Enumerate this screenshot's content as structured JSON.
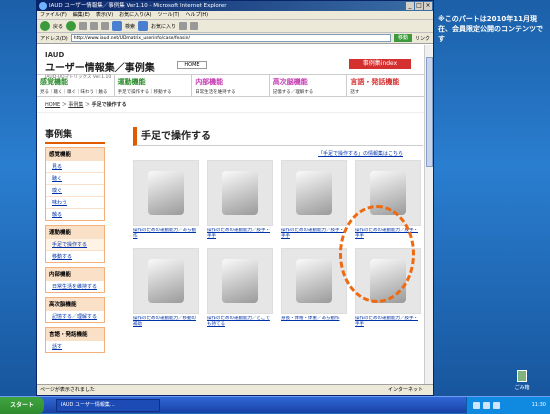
{
  "browser": {
    "title": "IAUD ユーザー情報集／事例集 Ver1.10 - Microsoft Internet Explorer",
    "window_controls": [
      "minimize-icon",
      "maximize-icon",
      "close-icon"
    ],
    "menu": [
      "ファイル(F)",
      "編集(E)",
      "表示(V)",
      "お気に入り(A)",
      "ツール(T)",
      "ヘルプ(H)"
    ],
    "toolbar": {
      "back_label": "戻る",
      "search_label": "検索",
      "favorites_label": "お気に入り"
    },
    "address_label": "アドレス(D)",
    "address_value": "http://www.iaud.net/UDmatrix_userinfo/case/feasin/",
    "go_label": "移動",
    "links_label": "リンク",
    "status_text": "ページが表示されました",
    "status_zone": "インターネット"
  },
  "site": {
    "brand": "IAUD",
    "title": "ユーザー情報集／事例集",
    "subtitle": "IAUD-UDマトリックス Ver.1.10",
    "home_button": "HOME",
    "index_button": "事例集index",
    "categories": [
      {
        "title": "感覚機能",
        "items": "見る｜聴く｜嗅ぐ｜味わう｜触る",
        "color": "#2a8a2a"
      },
      {
        "title": "運動機能",
        "items": "手足で操作する｜移動する",
        "color": "#2a8a2a"
      },
      {
        "title": "内部機能",
        "items": "日常生活を維持する",
        "color": "#c43ab0"
      },
      {
        "title": "高次脳機能",
        "items": "記憶する／理解する",
        "color": "#c43ab0"
      },
      {
        "title": "言語・発話機能",
        "items": "話す",
        "color": "#d43030"
      }
    ],
    "breadcrumb": {
      "home": "HOME",
      "case": "事例集",
      "current": "手足で操作する"
    },
    "sidebar": {
      "title": "事例集",
      "groups": [
        {
          "title": "感覚機能",
          "items": [
            "見る",
            "聴く",
            "嗅ぐ",
            "味わう",
            "触る"
          ]
        },
        {
          "title": "運動機能",
          "items": [
            "手足で操作する",
            "移動する"
          ]
        },
        {
          "title": "内部機能",
          "items": [
            "日常生活を維持する"
          ]
        },
        {
          "title": "高次脳機能",
          "items": [
            "記憶する／理解する"
          ]
        },
        {
          "title": "言語・発話機能",
          "items": [
            "話す"
          ]
        }
      ]
    },
    "main": {
      "heading": "手足で操作する",
      "info_link": "「手足で操作する」の情報集はこちら",
      "cards": [
        {
          "caption": "操作のための運動能力／あら動作"
        },
        {
          "caption": "操作のための運動能力／肢手・手手"
        },
        {
          "caption": "操作のための運動能力／肢手・手手"
        },
        {
          "caption": "操作のための運動能力／肢手・手手"
        },
        {
          "caption": "操作のための運動能力／移動の補助"
        },
        {
          "caption": "操作のための運動能力／どこでも持てる"
        },
        {
          "caption": "身長・体格・体重／あら動作"
        },
        {
          "caption": "操作のための運動能力／肢手・手手"
        }
      ]
    }
  },
  "overlay_note": "※このパートは2010年11月現在、会員限定公開のコンテンツです",
  "desktop": {
    "recycle_label": "ごみ箱",
    "start_label": "スタート",
    "task_label": "IAUD ユーザー情報集…",
    "clock": "11:30"
  }
}
